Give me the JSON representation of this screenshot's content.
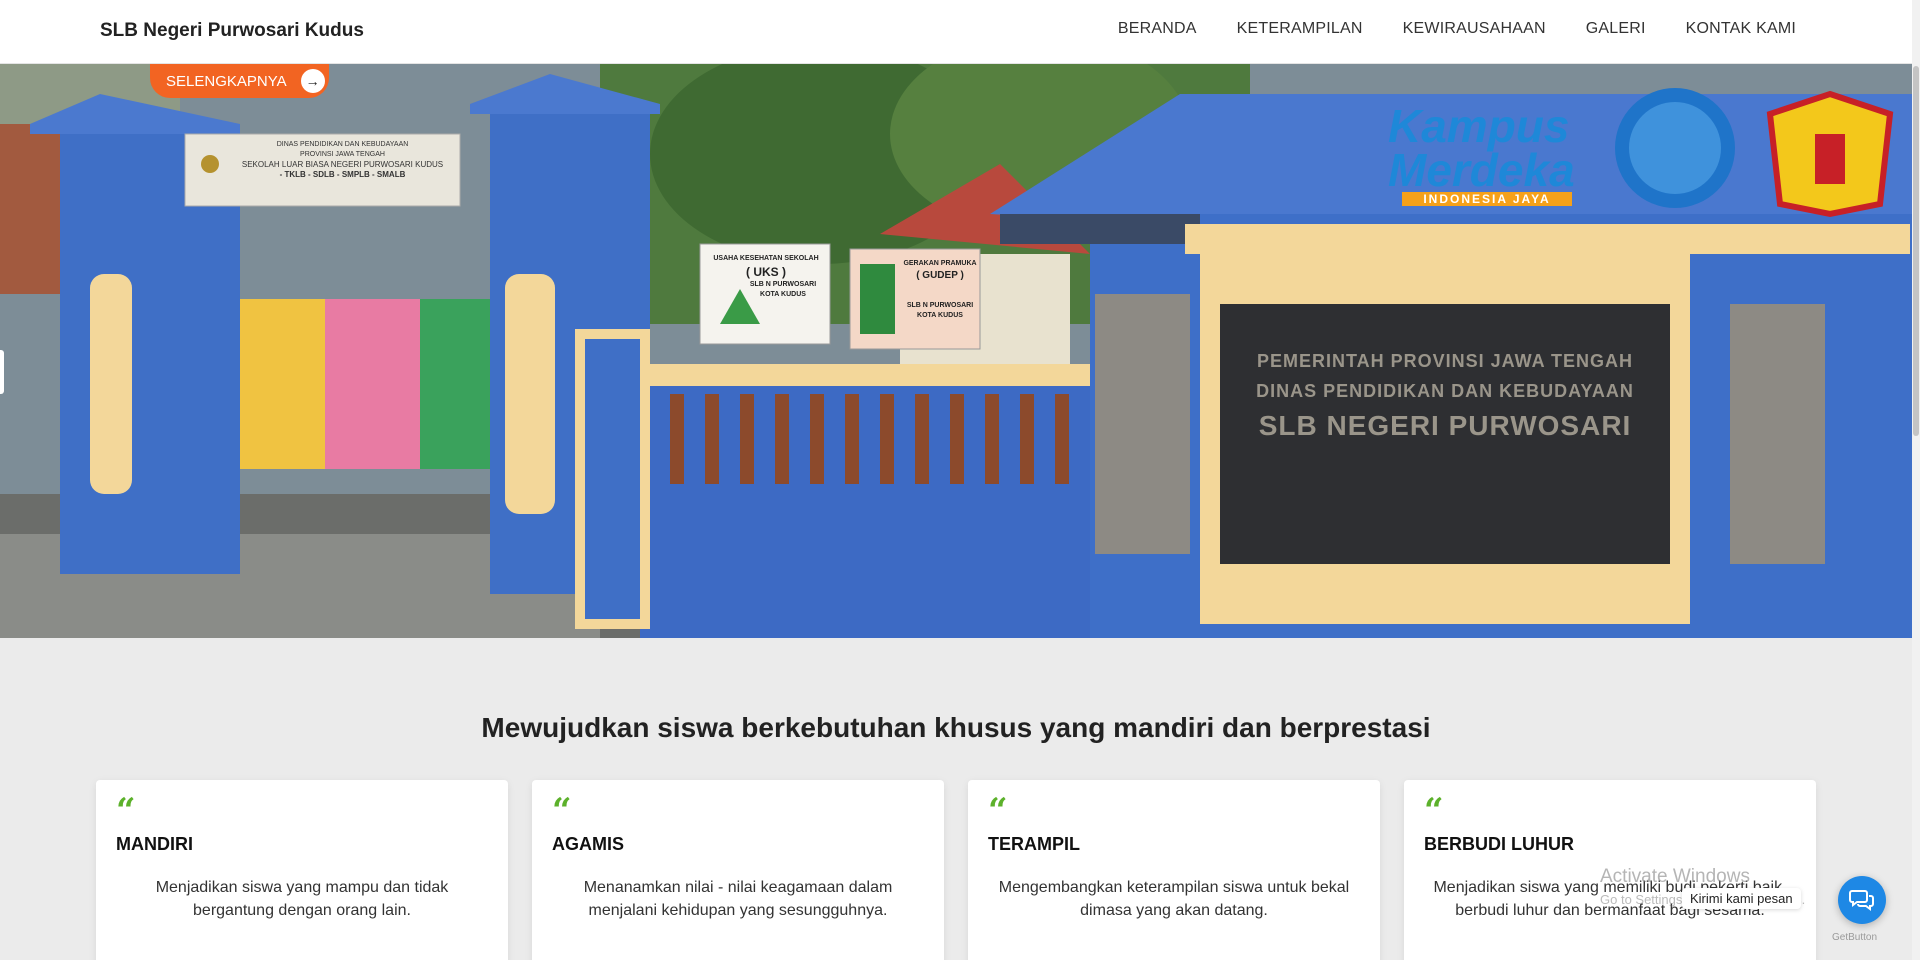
{
  "header": {
    "brand": "SLB Negeri Purwosari Kudus",
    "menu": [
      "BERANDA",
      "KETERAMPILAN",
      "KEWIRAUSAHAAN",
      "GALERI",
      "KONTAK KAMI"
    ]
  },
  "hero": {
    "cta_label": "SELENGKAPNYA",
    "signs": {
      "gate_top": "DINAS PENDIDIKAN DAN KEBUDAYAAN",
      "gate_mid": "PROVINSI JAWA TENGAH",
      "gate_name": "SEKOLAH LUAR BIASA NEGERI PURWOSARI KUDUS",
      "gate_levels": "- TKLB - SDLB - SMPLB - SMALB",
      "uks_title": "USAHA KESEHATAN SEKOLAH",
      "uks_code": "( UKS )",
      "uks_school": "SLB N PURWOSARI",
      "uks_city": "KOTA KUDUS",
      "gudep_title": "GERAKAN PRAMUKA",
      "gudep_code": "( GUDEP )",
      "gudep_school": "SLB N PURWOSARI",
      "gudep_city": "KOTA KUDUS",
      "plaque_line1": "PEMERINTAH PROVINSI JAWA TENGAH",
      "plaque_line2": "DINAS PENDIDIKAN DAN KEBUDAYAAN",
      "plaque_line3": "SLB NEGERI PURWOSARI",
      "kampus_line1": "Kampus",
      "kampus_line2": "Merdeka",
      "kampus_tag": "INDONESIA JAYA"
    },
    "colors": {
      "cta": "#f26422",
      "wall_blue": "#3f6fc6",
      "trim_cream": "#f3d79a"
    }
  },
  "section": {
    "headline": "Mewujudkan siswa berkebutuhan khusus yang mandiri dan berprestasi",
    "quote_glyph": "“",
    "cards": [
      {
        "title": "MANDIRI",
        "text": "Menjadikan siswa yang mampu dan tidak bergantung dengan orang lain."
      },
      {
        "title": "AGAMIS",
        "text": "Menanamkan nilai - nilai keagamaan dalam menjalani kehidupan yang sesungguhnya."
      },
      {
        "title": "TERAMPIL",
        "text": "Mengembangkan keterampilan siswa untuk bekal dimasa yang akan datang."
      },
      {
        "title": "BERBUDI LUHUR",
        "text": "Menjadikan siswa yang memiliki budi pekerti baik, berbudi luhur dan bermanfaat bagi sesama."
      }
    ],
    "accent_color": "#5cb12b"
  },
  "overlay": {
    "watermark_title": "Activate Windows",
    "watermark_sub": "Go to Settings to activate Windows.",
    "chat_label": "Kirimi kami pesan",
    "chat_icon": "chat-bubbles-icon",
    "getbutton": "GetButton"
  }
}
